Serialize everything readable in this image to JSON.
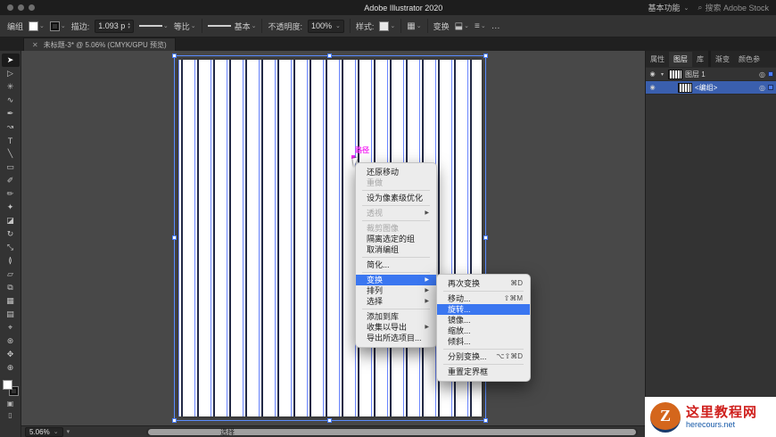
{
  "icons": {
    "chevron_down": "⌄",
    "submenu_arrow": "▶",
    "close": "✕",
    "search": "⌕",
    "eye": "◉",
    "target": "◎",
    "expand": "▾",
    "up": "▴",
    "down": "▾",
    "more": "…",
    "grid": "▦",
    "align": "≡",
    "transform_icon": "⬓"
  },
  "menubar": {
    "app_name": "Adobe Illustrator 2020",
    "workspace_label": "基本功能",
    "search_label": "搜索 Adobe Stock"
  },
  "control_bar": {
    "selection_label": "编组",
    "stroke_label": "描边:",
    "stroke_value": "1.093 p",
    "profile_label": "等比",
    "brush_label": "基本",
    "opacity_label": "不透明度:",
    "opacity_value": "100%",
    "style_label": "样式:",
    "transform_label": "变换"
  },
  "document_tab": {
    "title": "未标题-3* @ 5.06% (CMYK/GPU 预览)"
  },
  "toolbar": {
    "tools": [
      {
        "name": "selection-tool",
        "glyph": "➤",
        "active": true
      },
      {
        "name": "direct-selection-tool",
        "glyph": "▷"
      },
      {
        "name": "magic-wand-tool",
        "glyph": "✳"
      },
      {
        "name": "lasso-tool",
        "glyph": "∿"
      },
      {
        "name": "pen-tool",
        "glyph": "✒"
      },
      {
        "name": "curvature-tool",
        "glyph": "↝"
      },
      {
        "name": "type-tool",
        "glyph": "T"
      },
      {
        "name": "line-segment-tool",
        "glyph": "╲"
      },
      {
        "name": "rectangle-tool",
        "glyph": "▭"
      },
      {
        "name": "paintbrush-tool",
        "glyph": "✐"
      },
      {
        "name": "pencil-tool",
        "glyph": "✏"
      },
      {
        "name": "shaper-tool",
        "glyph": "✦"
      },
      {
        "name": "eraser-tool",
        "glyph": "◪"
      },
      {
        "name": "rotate-tool",
        "glyph": "↻"
      },
      {
        "name": "scale-tool",
        "glyph": "⤡"
      },
      {
        "name": "width-tool",
        "glyph": "≬"
      },
      {
        "name": "free-transform-tool",
        "glyph": "▱"
      },
      {
        "name": "shape-builder-tool",
        "glyph": "⧉"
      },
      {
        "name": "mesh-tool",
        "glyph": "▦"
      },
      {
        "name": "gradient-tool",
        "glyph": "▤"
      },
      {
        "name": "eyedropper-tool",
        "glyph": "⌖"
      },
      {
        "name": "blend-tool",
        "glyph": "⊛"
      },
      {
        "name": "hand-tool",
        "glyph": "✥"
      },
      {
        "name": "zoom-tool",
        "glyph": "⊕"
      }
    ]
  },
  "canvas": {
    "smart_guide_label": "路径"
  },
  "context_menu": {
    "items": [
      {
        "id": "undo-move",
        "label": "还原移动"
      },
      {
        "id": "redo",
        "label": "重做",
        "disabled": true
      },
      {
        "type": "sep"
      },
      {
        "id": "make-pixel-perfect",
        "label": "设为像素级优化"
      },
      {
        "type": "sep"
      },
      {
        "id": "perspective",
        "label": "透视",
        "disabled": true,
        "submenu": true
      },
      {
        "type": "sep"
      },
      {
        "id": "crop-image",
        "label": "裁剪图像",
        "disabled": true
      },
      {
        "id": "isolate-selected-group",
        "label": "隔离选定的组"
      },
      {
        "id": "ungroup",
        "label": "取消编组"
      },
      {
        "type": "sep"
      },
      {
        "id": "simplify",
        "label": "简化..."
      },
      {
        "type": "sep"
      },
      {
        "id": "transform",
        "label": "变换",
        "submenu": true,
        "highlighted": true
      },
      {
        "id": "arrange",
        "label": "排列",
        "submenu": true
      },
      {
        "id": "select",
        "label": "选择",
        "submenu": true
      },
      {
        "type": "sep"
      },
      {
        "id": "add-to-library",
        "label": "添加到库"
      },
      {
        "id": "collect-for-export",
        "label": "收集以导出",
        "submenu": true
      },
      {
        "id": "export-selection",
        "label": "导出所选项目..."
      }
    ]
  },
  "transform_submenu": {
    "items": [
      {
        "id": "transform-again",
        "label": "再次变换",
        "shortcut": "⌘D"
      },
      {
        "type": "sep"
      },
      {
        "id": "move",
        "label": "移动...",
        "shortcut": "⇧⌘M"
      },
      {
        "id": "rotate",
        "label": "旋转...",
        "highlighted": true
      },
      {
        "id": "reflect",
        "label": "镜像..."
      },
      {
        "id": "scale",
        "label": "缩放..."
      },
      {
        "id": "shear",
        "label": "倾斜..."
      },
      {
        "type": "sep"
      },
      {
        "id": "transform-each",
        "label": "分别变换...",
        "shortcut": "⌥⇧⌘D"
      },
      {
        "type": "sep"
      },
      {
        "id": "reset-bounding-box",
        "label": "重置定界框"
      }
    ]
  },
  "right_panel": {
    "tab_groups": [
      {
        "tabs": [
          {
            "label": "属性"
          },
          {
            "label": "图层",
            "active": true
          },
          {
            "label": "库"
          }
        ]
      },
      {
        "tabs": [
          {
            "label": "渐变"
          },
          {
            "label": "颜色参"
          }
        ]
      }
    ],
    "layers": [
      {
        "name": "图层 1",
        "indent": 0,
        "selected": false,
        "expandable": true
      },
      {
        "name": "<编组>",
        "indent": 1,
        "selected": true,
        "expandable": false
      }
    ]
  },
  "status_bar": {
    "zoom_value": "5.06%",
    "tool_label": "选择"
  },
  "watermark": {
    "logo_letter": "Z",
    "title": "这里教程网",
    "url": "herecours.net"
  }
}
